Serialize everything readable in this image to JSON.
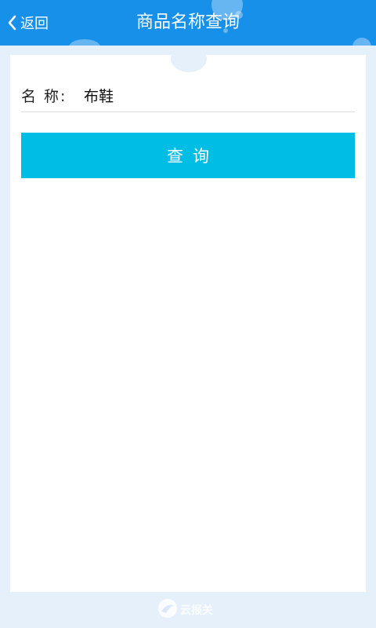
{
  "header": {
    "back_label": "返回",
    "title": "商品名称查询",
    "background": "#1790ea"
  },
  "form": {
    "name_label": "名 称:",
    "name_value": "布鞋",
    "query_button_label": "查询",
    "button_color": "#00bde6"
  },
  "footer": {
    "logo_text": "云报关"
  },
  "icons": {
    "back": "chevron-left-icon",
    "logo": "cloud-logo-icon"
  }
}
